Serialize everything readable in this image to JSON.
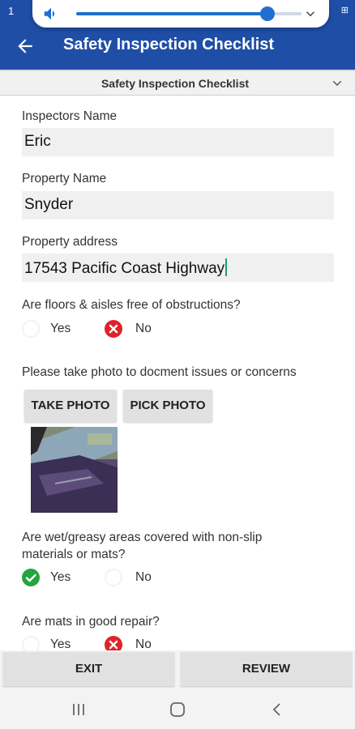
{
  "status_bar": {
    "time": "1",
    "right": "⊞"
  },
  "volume": {
    "level": 0.85,
    "icon": "volume-icon",
    "expand_icon": "chevron-down-icon"
  },
  "appbar": {
    "title": "Safety Inspection Checklist",
    "back_icon": "arrow-left-icon",
    "color": "#1f4ea6"
  },
  "section": {
    "title": "Safety Inspection Checklist",
    "icon": "chevron-down-icon"
  },
  "form": {
    "inspector": {
      "label": "Inspectors Name",
      "value": "Eric"
    },
    "property": {
      "label": "Property Name",
      "value": "Snyder"
    },
    "address": {
      "label": "Property address",
      "value": "17543 Pacific Coast Highway"
    },
    "q1": {
      "question": "Are floors & aisles free of obstructions?",
      "yes": "Yes",
      "no": "No",
      "selected": "No"
    },
    "photo": {
      "prompt": "Please take photo to docment issues or concerns",
      "take": "TAKE PHOTO",
      "pick": "PICK PHOTO"
    },
    "q2": {
      "question_line1": "Are wet/greasy areas covered with non-slip",
      "question_line2": "materials or mats?",
      "yes": "Yes",
      "no": "No",
      "selected": "Yes"
    },
    "q3": {
      "question": "Are mats in good repair?",
      "yes": "Yes",
      "no": "No",
      "selected": "No"
    }
  },
  "actions": {
    "exit": "EXIT",
    "review": "REVIEW"
  },
  "colors": {
    "accent": "#1f4ea6",
    "no_selected": "#e0232a",
    "yes_selected": "#24a53f"
  }
}
